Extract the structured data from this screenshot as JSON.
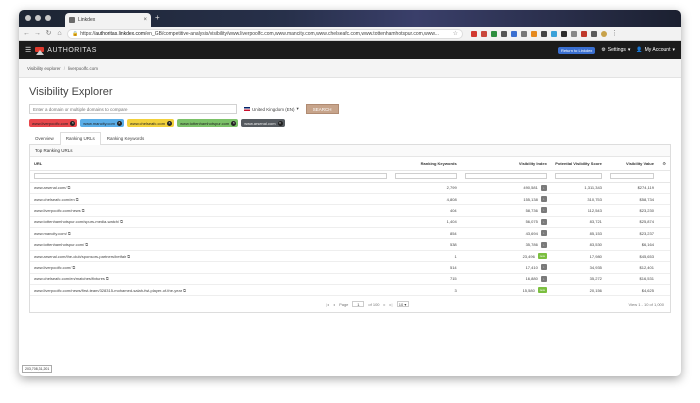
{
  "browser": {
    "tab_title": "Linkdex",
    "url_prefix": "https://",
    "url_domain": "authoritas.linkdex.com",
    "url_rest": "/en_GB/competitive-analysis/visibility/www.liverpoolfc.com,www.mancity.com,www.chelseafc.com,www.tottenhamhotspur.com,www..."
  },
  "app": {
    "logo": "AUTHORITAS",
    "hello_badge": "Return to Linkdex",
    "settings": "Settings",
    "account": "My Account"
  },
  "breadcrumb": [
    "Visibility explorer",
    "liverpoolfc.com"
  ],
  "page": {
    "title": "Visibility Explorer",
    "domain_placeholder": "Enter a domain or multiple domains to compare",
    "country": "United Kingdom (EN)",
    "search_button": "SEARCH"
  },
  "chips": [
    {
      "label": "www.liverpoolfc.com",
      "color": "#e8474c"
    },
    {
      "label": "www.mancity.com",
      "color": "#5aaee8"
    },
    {
      "label": "www.chelseafc.com",
      "color": "#f2d13b"
    },
    {
      "label": "www.tottenhamhotspur.com",
      "color": "#7cc269"
    },
    {
      "label": "www.arsenal.com",
      "color": "#555a5f"
    }
  ],
  "tabs": [
    "Overview",
    "Ranking URLs",
    "Ranking Keywords"
  ],
  "panel_title": "Top Ranking URLs",
  "table": {
    "headers": [
      "URL",
      "Ranking Keywords",
      "Visibility Index",
      "Potential Visibility Score",
      "Visibility Value"
    ],
    "rows": [
      {
        "url": "www.arsenal.com/",
        "kw": "2,799",
        "vi": "490,581",
        "badge": "↓",
        "pvs": "1,311,343",
        "val": "$274,119"
      },
      {
        "url": "www.chelseafc.com/en",
        "kw": "4,808",
        "vi": "155,138",
        "badge": "↓",
        "pvs": "310,753",
        "val": "$58,734"
      },
      {
        "url": "www.liverpoolfc.com/news",
        "kw": "404",
        "vi": "58,736",
        "badge": "↓",
        "pvs": "112,543",
        "val": "$23,230"
      },
      {
        "url": "www.tottenhamhotspur.com/spurs-media-watch/",
        "kw": "1,404",
        "vi": "56,075",
        "badge": "↓",
        "pvs": "83,721",
        "val": "$25,874"
      },
      {
        "url": "www.mancity.com/",
        "kw": "854",
        "vi": "43,694",
        "badge": "↓",
        "pvs": "85,153",
        "val": "$23,237"
      },
      {
        "url": "www.tottenhamhotspur.com/",
        "kw": "538",
        "vi": "35,786",
        "badge": "↓",
        "pvs": "83,530",
        "val": "$6,164"
      },
      {
        "url": "www.arsenal.com/the-club/sponsors-partners/betfair",
        "kw": "1",
        "vi": "23,496",
        "badge": "new",
        "pvs": "17,980",
        "val": "$45,653"
      },
      {
        "url": "www.liverpoolfc.com/",
        "kw": "514",
        "vi": "17,410",
        "badge": "↓",
        "pvs": "34,935",
        "val": "$12,401"
      },
      {
        "url": "www.chelseafc.com/en/matches/fixtures",
        "kw": "715",
        "vi": "16,880",
        "badge": "↓",
        "pvs": "35,272",
        "val": "$16,531"
      },
      {
        "url": "www.liverpoolfc.com/news/first-team/328315-mohamed-salah-fwl-player-of-the-year",
        "kw": "3",
        "vi": "15,580",
        "badge": "new",
        "pvs": "20,156",
        "val": "$4,625"
      }
    ]
  },
  "pager": {
    "page_label": "Page",
    "page_num": "1",
    "of_label": "of 100",
    "view_label": "View 1 - 10 of 1,000"
  },
  "status": "203,708,31,201"
}
